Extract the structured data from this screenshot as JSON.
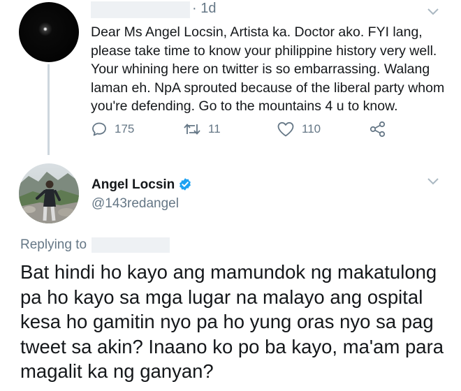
{
  "tweet1": {
    "timestamp": "· 1d",
    "text": "Dear Ms Angel Locsin, Artista ka. Doctor ako. FYI lang, please take time to know your philippine history very well. Your whining here on twitter is so embarrassing. Walang laman eh. NpA sprouted because of the liberal party whom you're defending. Go to the mountains 4 u to know.",
    "actions": {
      "reply_count": "175",
      "retweet_count": "11",
      "like_count": "110"
    }
  },
  "tweet2": {
    "display_name": "Angel Locsin",
    "handle": "@143redangel",
    "replying_label": "Replying to",
    "text": "Bat hindi ho kayo ang mamundok ng makatulong pa ho kayo sa mga lugar na malayo ang ospital kesa ho gamitin nyo pa ho yung oras nyo sa pag tweet sa akin? Inaano ko po ba kayo, ma'am para magalit ka ng ganyan?"
  },
  "icons": [
    "reply-icon",
    "retweet-icon",
    "like-icon",
    "share-icon",
    "chevron-down-icon",
    "verified-icon"
  ],
  "colors": {
    "secondary_text": "#657786",
    "primary_text": "#14171a",
    "verified_blue": "#1da1f2",
    "thread_line": "#cdd6dd"
  }
}
